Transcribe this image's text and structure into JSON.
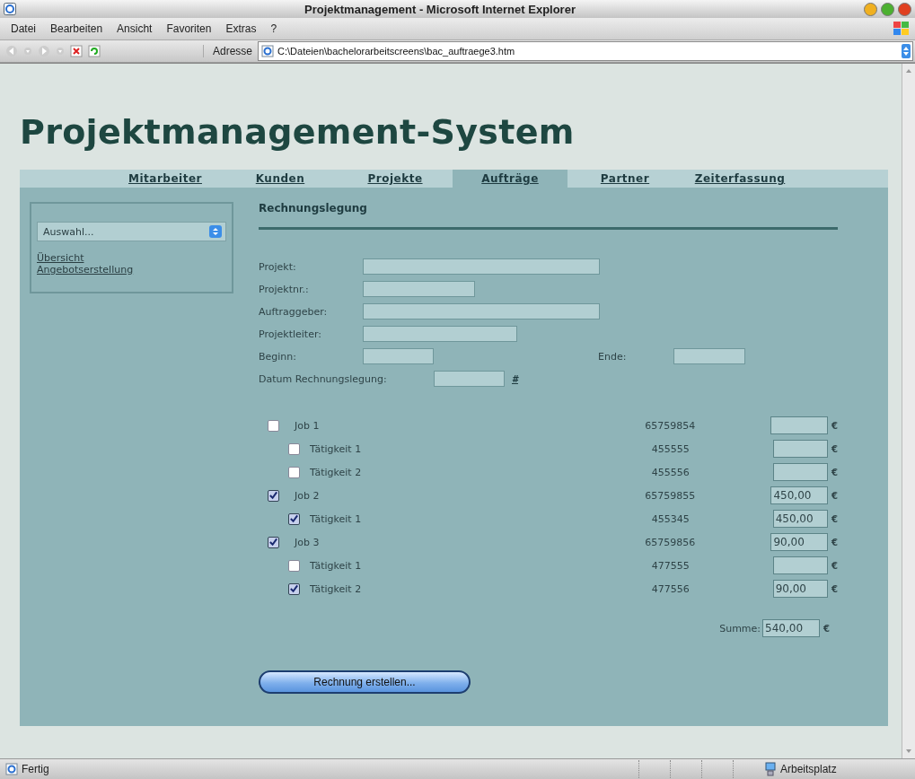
{
  "window": {
    "title": "Projektmanagement - Microsoft Internet Explorer"
  },
  "menu": [
    "Datei",
    "Bearbeiten",
    "Ansicht",
    "Favoriten",
    "Extras",
    "?"
  ],
  "address": {
    "label": "Adresse",
    "value": "C:\\Dateien\\bachelorarbeitscreens\\bac_auftraege3.htm"
  },
  "page": {
    "heading": "Projektmanagement-System",
    "tabs": [
      {
        "label": "Mitarbeiter",
        "selected": false
      },
      {
        "label": "Kunden",
        "selected": false
      },
      {
        "label": "Projekte",
        "selected": false
      },
      {
        "label": "Aufträge",
        "selected": true
      },
      {
        "label": "Partner",
        "selected": false
      },
      {
        "label": "Zeiterfassung",
        "selected": false
      }
    ],
    "sidebar": {
      "select": "Auswahl...",
      "links": [
        "Übersicht",
        "Angebotserstellung"
      ]
    },
    "section_title": "Rechnungslegung",
    "fields": [
      {
        "label": "Projekt:"
      },
      {
        "label": "Projektnr.:"
      },
      {
        "label": "Auftraggeber:"
      },
      {
        "label": "Projektleiter:"
      }
    ],
    "dates": {
      "begin_label": "Beginn:",
      "end_label": "Ende:"
    },
    "invoice_date": {
      "label": "Datum Rechnungslegung:",
      "picker": "#"
    },
    "jobs": [
      {
        "label": "Job 1",
        "number": "65759854",
        "checked": false,
        "children": [
          {
            "label": "Tätigkeit 1",
            "number": "455555",
            "checked": false
          },
          {
            "label": "Tätigkeit 2",
            "number": "455556",
            "checked": false
          }
        ]
      },
      {
        "label": "Job 2",
        "number": "65759855",
        "checked": true,
        "amount": "450,00",
        "children": [
          {
            "label": "Tätigkeit 1",
            "number": "455345",
            "checked": true,
            "amount": "450,00"
          }
        ]
      },
      {
        "label": "Job 3",
        "number": "65759856",
        "checked": true,
        "amount": "90,00",
        "children": [
          {
            "label": "Tätigkeit 1",
            "number": "477555",
            "checked": false
          },
          {
            "label": "Tätigkeit 2",
            "number": "477556",
            "checked": true,
            "amount": "90,00"
          }
        ]
      }
    ],
    "currency": "€",
    "sum": {
      "label": "Summe:",
      "value": "540,00"
    },
    "button": "Rechnung erstellen..."
  },
  "status_bar": {
    "left": "Fertig",
    "zone": "Arbeitsplatz"
  }
}
